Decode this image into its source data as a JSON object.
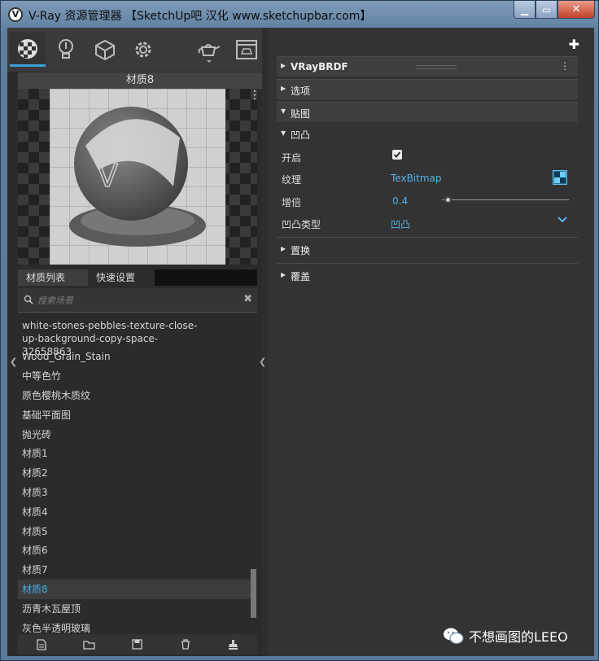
{
  "window": {
    "title": "V-Ray 资源管理器 【SketchUp吧 汉化 www.sketchupbar.com】",
    "app_icon_glyph": "V",
    "controls": {
      "min": "▁",
      "max": "▭",
      "close": "✕"
    }
  },
  "toolbar": {
    "icons": [
      "materials-icon",
      "lights-icon",
      "geometry-icon",
      "settings-icon",
      "teapot-render-icon",
      "frame-buffer-icon"
    ]
  },
  "preview": {
    "title": "材质8",
    "menu_glyph": "⋮",
    "watermark_text": "V"
  },
  "tabs": {
    "material_list": "材质列表",
    "quick_settings": "快速设置"
  },
  "search": {
    "placeholder": "搜索场景",
    "clear": "✖"
  },
  "materials": [
    "white-stones-pebbles-texture-close-up-background-copy-space-32658863",
    "Wood_Grain_Stain",
    "中等色竹",
    "原色樱桃木质纹",
    "基础平面图",
    "抛光砖",
    "材质1",
    "材质2",
    "材质3",
    "材质4",
    "材质5",
    "材质6",
    "材质7",
    "材质8",
    "沥青木瓦屋顶",
    "灰色半透明玻璃"
  ],
  "selected_material": "材质8",
  "right_panel": {
    "add_glyph": "✚",
    "brdf_section": "VRayBRDF",
    "options_section": "选项",
    "maps_section": "贴图",
    "bump_subsection": "凹凸",
    "props": {
      "enable_label": "开启",
      "texture_label": "纹理",
      "texture_value": "TexBitmap",
      "multiplier_label": "增倍",
      "multiplier_value": "0.4",
      "bump_type_label": "凹凸类型",
      "bump_type_value": "凹凸"
    },
    "displacement_section": "置换",
    "overrides_section": "覆盖"
  },
  "watermark": {
    "text": "不想画图的LEEO"
  },
  "colors": {
    "accent": "#3aa0d6",
    "link": "#58b0e6",
    "panel": "#333333",
    "close": "#c2412b"
  }
}
